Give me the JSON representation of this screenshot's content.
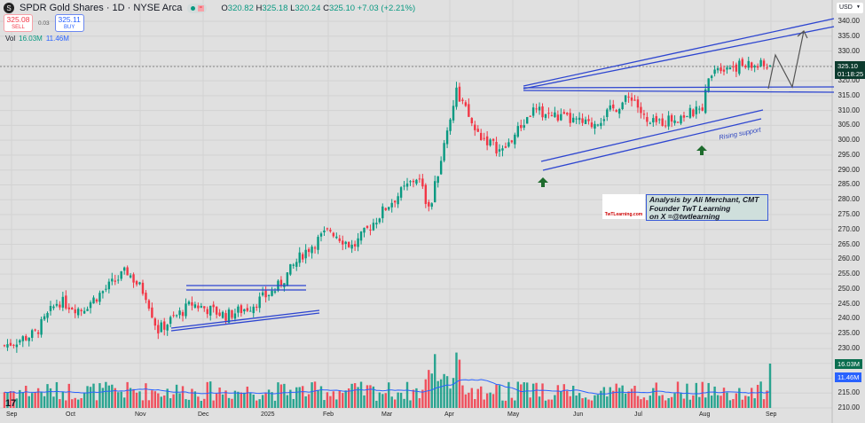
{
  "header": {
    "symbol_icon": "S",
    "title": "SPDR Gold Shares · 1D · NYSE Arca",
    "open_label": "O",
    "open": "320.82",
    "high_label": "H",
    "high": "325.18",
    "low_label": "L",
    "low": "320.24",
    "close_label": "C",
    "close": "325.10",
    "change": "+7.03 (+2.21%)"
  },
  "trade": {
    "sell_price": "325.08",
    "sell_label": "SELL",
    "spread": "0.03",
    "buy_price": "325.11",
    "buy_label": "BUY"
  },
  "volume_legend": {
    "label": "Vol",
    "volume": "16.03M",
    "ma": "11.46M"
  },
  "currency": "USD",
  "price_tag": {
    "price": "325.10",
    "countdown": "01:18:25"
  },
  "volume_tags": {
    "volume": "16.03M",
    "ma": "11.46M"
  },
  "annotation": {
    "line1": "Analysis by Ali Merchant, CMT",
    "line2": "Founder TwT Learning",
    "line3": "on X =@twtlearning",
    "logo_text": "TwTLearning.com"
  },
  "rising_support_label": "Rising support",
  "colors": {
    "up": "#089981",
    "down": "#f23645",
    "trend": "#2d45d0",
    "ma": "#2962ff"
  },
  "chart_data": {
    "type": "candlestick",
    "y_ticks": [
      "340.00",
      "335.00",
      "330.00",
      "320.00",
      "315.00",
      "310.00",
      "305.00",
      "300.00",
      "295.00",
      "290.00",
      "285.00",
      "280.00",
      "275.00",
      "270.00",
      "265.00",
      "260.00",
      "255.00",
      "250.00",
      "245.00",
      "240.00",
      "235.00",
      "230.00",
      "215.00",
      "210.00"
    ],
    "ylim": [
      210,
      340
    ],
    "x_ticks": [
      "Sep",
      "Oct",
      "Nov",
      "Dec",
      "2025",
      "Feb",
      "Mar",
      "Apr",
      "May",
      "Jun",
      "Jul",
      "Aug",
      "Sep"
    ],
    "close_path": [
      [
        0,
        231
      ],
      [
        0.04,
        235
      ],
      [
        0.07,
        246
      ],
      [
        0.1,
        243
      ],
      [
        0.16,
        256
      ],
      [
        0.185,
        248
      ],
      [
        0.2,
        236
      ],
      [
        0.245,
        245
      ],
      [
        0.29,
        241
      ],
      [
        0.32,
        244
      ],
      [
        0.355,
        250
      ],
      [
        0.39,
        262
      ],
      [
        0.425,
        270
      ],
      [
        0.455,
        264
      ],
      [
        0.5,
        278
      ],
      [
        0.54,
        288
      ],
      [
        0.555,
        276
      ],
      [
        0.59,
        317
      ],
      [
        0.615,
        303
      ],
      [
        0.65,
        296
      ],
      [
        0.69,
        310
      ],
      [
        0.765,
        305
      ],
      [
        0.82,
        315
      ],
      [
        0.84,
        305
      ],
      [
        0.91,
        310
      ],
      [
        0.925,
        325
      ]
    ]
  }
}
